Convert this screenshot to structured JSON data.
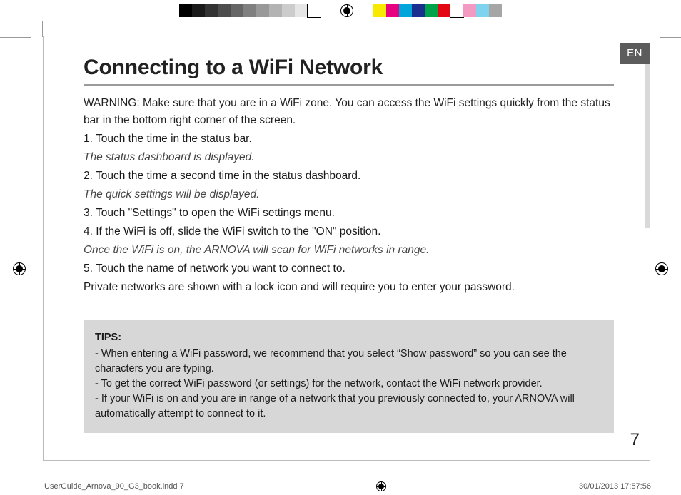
{
  "colorbar": {
    "left": [
      "#000000",
      "#1a1a1a",
      "#333333",
      "#4d4d4d",
      "#666666",
      "#808080",
      "#999999",
      "#b3b3b3",
      "#cccccc",
      "#e6e6e6",
      "#ffffff"
    ],
    "right": [
      "#f7ea00",
      "#e7007f",
      "#00a5d9",
      "#1b2f8f",
      "#00a34a",
      "#e30613",
      "#ffffff",
      "#f29ac2",
      "#7fd3ef",
      "#a6a6a6"
    ]
  },
  "lang_tab": "EN",
  "title": "Connecting to a WiFi Network",
  "warning": "WARNING:  Make sure that you are in a WiFi zone. You can access the WiFi settings quickly from the status bar in the bottom right corner of the screen.",
  "steps": {
    "s1": "1. Touch the time in the status bar.",
    "n1": "The status dashboard is displayed.",
    "s2": "2. Touch the time a second time in the status dashboard.",
    "n2": "The quick settings will be displayed.",
    "s3": "3. Touch \"Settings\" to open the WiFi settings menu.",
    "s4": "4. If the WiFi is off, slide the WiFi switch to the \"ON\" position.",
    "n4": "Once the WiFi is on, the ARNOVA will scan for WiFi networks in range.",
    "s5": "5. Touch the name of network you want to connect to.",
    "n5": "Private networks are shown with a lock icon and will require you to enter your password."
  },
  "tips": {
    "heading": "TIPS:",
    "t1": "-   When entering a WiFi password, we recommend that you select “Show password” so you can see the characters you are typing.",
    "t2": "-   To get the correct WiFi password (or settings) for the network, contact the WiFi network provider.",
    "t3": "-   If your WiFi is on and you are in range of a network that you previously connected to, your ARNOVA will automatically attempt to connect to it."
  },
  "page_number": "7",
  "slug": {
    "file": "UserGuide_Arnova_90_G3_book.indd   7",
    "datetime": "30/01/2013   17:57:56"
  }
}
